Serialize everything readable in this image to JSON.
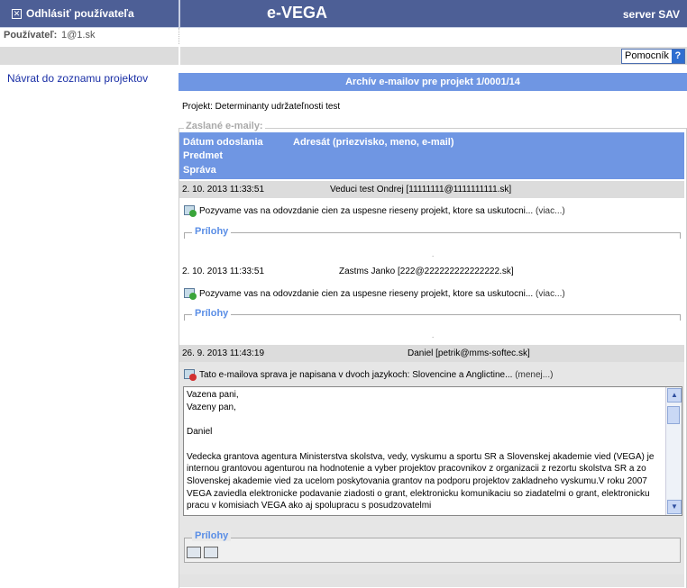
{
  "topbar": {
    "logout_label": "Odhlásiť používateľa",
    "app_title": "e-VEGA",
    "server_label": "server SAV"
  },
  "user": {
    "label": "Používateľ:",
    "value": "1@1.sk"
  },
  "toolbar": {
    "help_label": "Pomocník",
    "help_icon": "?"
  },
  "nav": {
    "back_link": "Návrat do zoznamu projektov"
  },
  "archive": {
    "header": "Archív e-mailov pre projekt 1/0001/14",
    "project_line": "Projekt: Determinanty udržateľnosti test",
    "fieldset_legend": "Zaslané e-maily:",
    "columns": {
      "date": "Dátum odoslania",
      "recipient": "Adresát (priezvisko, meno, e-mail)",
      "subject": "Predmet",
      "message": "Správa"
    },
    "attachments_label": "Prílohy",
    "emails": [
      {
        "date": "2. 10. 2013 11:33:51",
        "recipient": "Veduci test Ondrej [11111111@1111111111.sk]",
        "subject": "Pozyvame vas na odovzdanie cien za uspesne rieseny projekt, ktore sa uskutocni...",
        "toggle": "(viac...)"
      },
      {
        "date": "2. 10. 2013 11:33:51",
        "recipient": "Zastms Janko [222@222222222222222.sk]",
        "subject": "Pozyvame vas na odovzdanie cien za uspesne rieseny projekt, ktore sa uskutocni...",
        "toggle": "(viac...)"
      },
      {
        "date": "26. 9. 2013 11:43:19",
        "recipient": "Daniel [petrik@mms-softec.sk]",
        "subject": "Tato e-mailova sprava je napisana v dvoch jazykoch: Slovencine a Anglictine...",
        "toggle": "(menej...)",
        "body": "Vazena pani,\nVazeny pan,\n\nDaniel\n\nVedecka grantova agentura Ministerstva skolstva, vedy, vyskumu a sportu SR a Slovenskej akademie vied (VEGA) je internou grantovou agenturou na hodnotenie a vyber projektov pracovnikov z organizacii z rezortu skolstva SR a zo Slovenskej akademie vied za ucelom poskytovania grantov na podporu projektov zakladneho vyskumu.V roku 2007 VEGA zaviedla elektronicke podavanie ziadosti o grant, elektronicku komunikaciu so ziadatelmi o grant, elektronicku pracu v komisiach VEGA ako aj spolupracu s posudzovatelmi"
      }
    ]
  },
  "icons": {
    "logout": "close-box-icon",
    "mail_expand": "mail-expand-icon",
    "mail_collapse": "mail-collapse-icon",
    "attachment": "attachment-icon"
  },
  "colors": {
    "topbar": "#4d5f96",
    "header_blue": "#6f96e3",
    "row_gray": "#dcdcdc",
    "legend_blue": "#5a8ee6",
    "expand_green": "#3aa53a",
    "collapse_red": "#d23030"
  }
}
